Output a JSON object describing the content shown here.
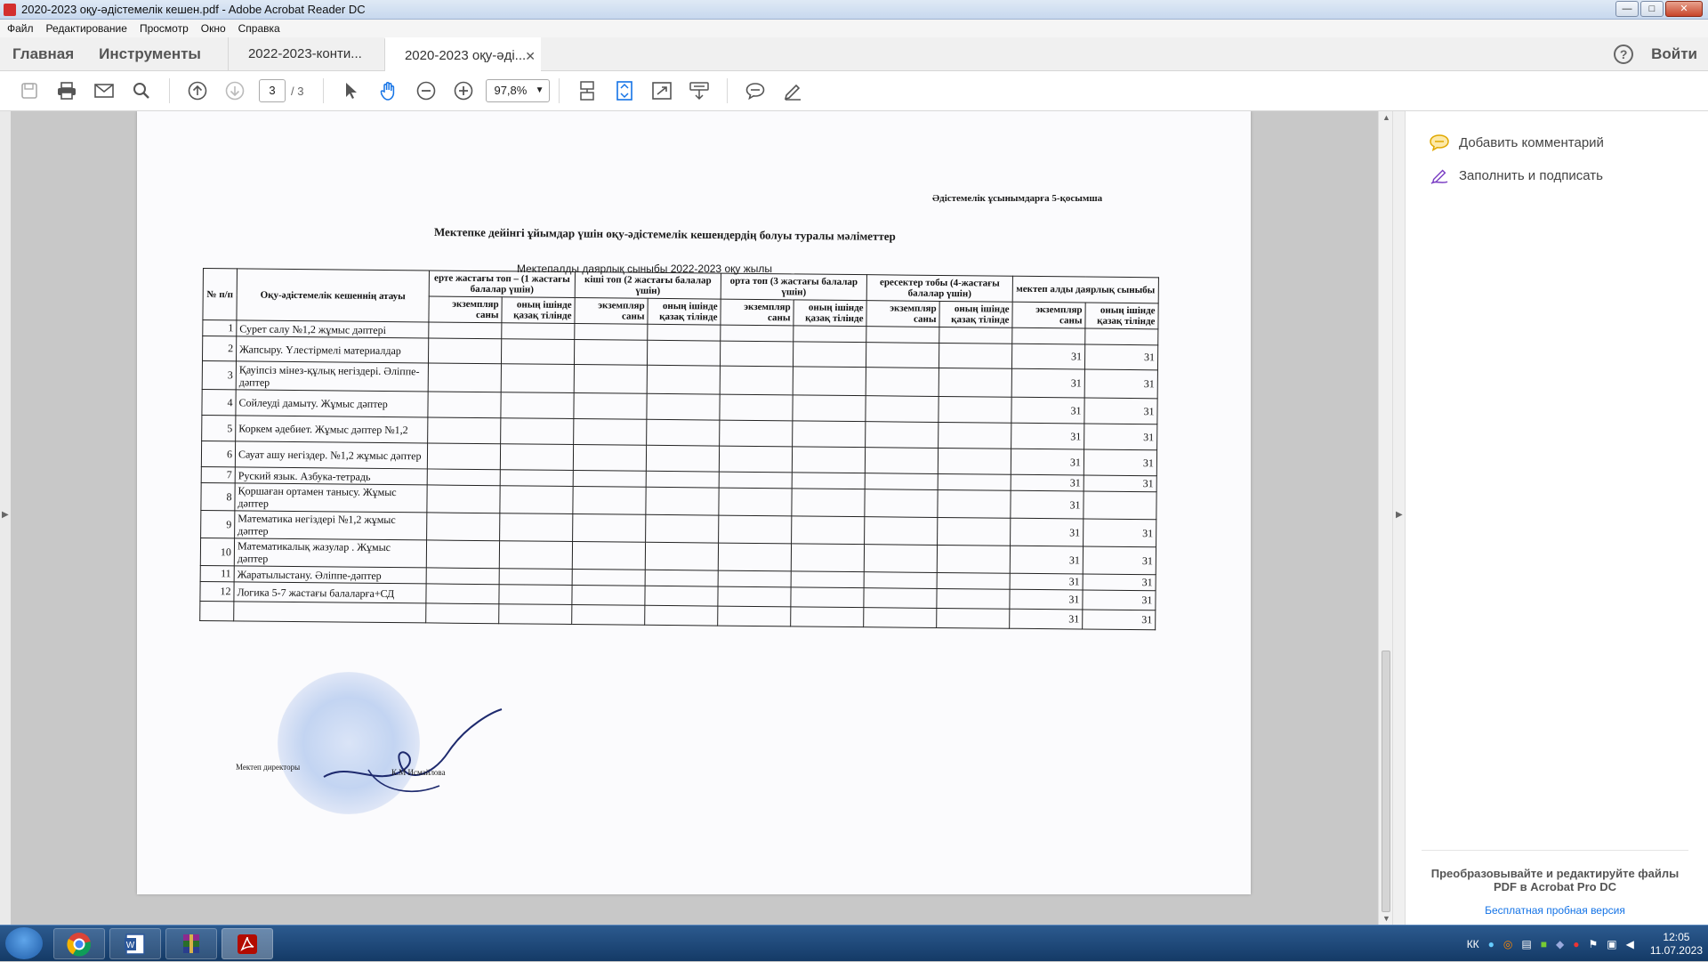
{
  "window": {
    "title": "2020-2023 оқу-әдістемелік кешен.pdf - Adobe Acrobat Reader DC",
    "minimize": "—",
    "maximize": "□",
    "close": "✕"
  },
  "menu": [
    "Файл",
    "Редактирование",
    "Просмотр",
    "Окно",
    "Справка"
  ],
  "nav": {
    "home": "Главная",
    "tools": "Инструменты",
    "signin": "Войти",
    "help": "?"
  },
  "tabs": [
    {
      "label": "2022-2023-конти...",
      "active": false
    },
    {
      "label": "2020-2023 оқу-әді...",
      "active": true,
      "close": "✕"
    }
  ],
  "toolbar": {
    "page_current": "3",
    "page_total": "/ 3",
    "zoom": "97,8%"
  },
  "right_panel": {
    "add_comment": "Добавить комментарий",
    "fill_sign": "Заполнить и подписать",
    "promo_text": "Преобразовывайте и редактируйте файлы PDF в Acrobat Pro DC",
    "promo_link": "Бесплатная пробная версия"
  },
  "document": {
    "appendix": "Әдістемелік ұсынымдарға 5-қосымша",
    "heading": "Мектепке дейінгі ұйымдар үшін оқу-әдістемелік кешендердің болуы туралы мәліметтер",
    "subheading": "Мектепалды даярлық сыныбы  2022-2023 оқу жылы",
    "table": {
      "col_num": "№ п/п",
      "col_name": "Оқу-әдістемелік кешеннің атауы",
      "groups": [
        "ерте жастағы топ – (1 жастағы балалар үшін)",
        "кіші топ (2 жастағы балалар үшін)",
        "орта топ (3 жастағы балалар үшін)",
        "ересектер тобы (4-жастағы балалар үшін)",
        "мектеп алды даярлық сыныбы"
      ],
      "sub_a": "экземпляр саны",
      "sub_b": "оның ішінде қазақ тілінде",
      "rows": [
        {
          "n": "1",
          "name": "Сурет салу №1,2 жұмыс дәптері",
          "a": "",
          "b": ""
        },
        {
          "n": "2",
          "name": "Жапсыру. Үлестірмелі материалдар",
          "a": "31",
          "b": "31"
        },
        {
          "n": "3",
          "name": "Қауіпсіз мінез-құлық негіздері. Әліппе-дәптер",
          "a": "31",
          "b": "31"
        },
        {
          "n": "4",
          "name": "Сойлеуді дамыту.  Жұмыс дәптер",
          "a": "31",
          "b": "31"
        },
        {
          "n": "5",
          "name": "Коркем әдебиет. Жұмыс дәптер №1,2",
          "a": "31",
          "b": "31"
        },
        {
          "n": "6",
          "name": "Сауат ашу негіздер. №1,2 жұмыс дәптер",
          "a": "31",
          "b": "31"
        },
        {
          "n": "7",
          "name": "Руский язык. Азбука-тетрадь",
          "a": "31",
          "b": "31"
        },
        {
          "n": "8",
          "name": "Қоршаған ортамен танысу.  Жұмыс дәптер",
          "a": "31",
          "b": ""
        },
        {
          "n": "9",
          "name": "Математика негіздері №1,2 жұмыс дәптер",
          "a": "31",
          "b": "31"
        },
        {
          "n": "10",
          "name": "Математикалық жазулар  . Жұмыс дәптер",
          "a": "31",
          "b": "31"
        },
        {
          "n": "11",
          "name": "Жаратылыстану. Әліппе-дәптер",
          "a": "31",
          "b": "31"
        },
        {
          "n": "12",
          "name": "Логика 5-7 жастағы балаларға+СД",
          "a": "31",
          "b": "31"
        }
      ],
      "extra_row": {
        "a": "31",
        "b": "31"
      }
    },
    "signature_role": "Мектеп директоры",
    "signature_name": "К.М Исмайлова"
  },
  "taskbar": {
    "lang": "КК",
    "time": "12:05",
    "date": "11.07.2023"
  }
}
